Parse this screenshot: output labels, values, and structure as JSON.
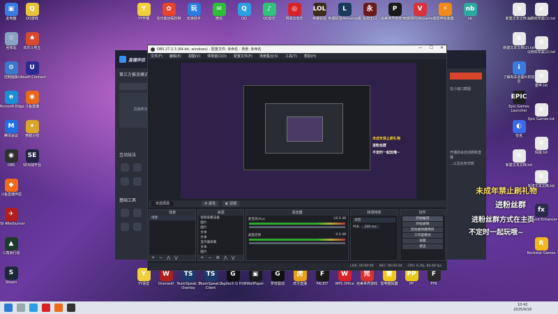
{
  "desktop_icons_left": [
    {
      "label": "此电脑",
      "color": "#3b7be0",
      "glyph": "▣"
    },
    {
      "label": "回收站",
      "color": "#8aa3c2",
      "glyph": "♲"
    },
    {
      "label": "控制面板",
      "color": "#3a78c9",
      "glyph": "⚙"
    },
    {
      "label": "Microsoft Edge",
      "color": "#1a8fd6",
      "glyph": "e"
    },
    {
      "label": "腾讯会议",
      "color": "#1f6fe0",
      "glyph": "M"
    },
    {
      "label": "OBS",
      "color": "#303030",
      "glyph": "◉"
    },
    {
      "label": "斗鱼直播伴侣",
      "color": "#f06a1a",
      "glyph": "◆"
    },
    {
      "label": "MSI Afterburner",
      "color": "#b01e1e",
      "glyph": "✈"
    },
    {
      "label": "三角洲行动",
      "color": "#1f3b2a",
      "glyph": "▲"
    },
    {
      "label": "Steam",
      "color": "#1b2838",
      "glyph": "S"
    }
  ],
  "desktop_icons_left2": [
    {
      "label": "QQ游戏",
      "color": "#e8c23a",
      "glyph": "Q"
    },
    {
      "label": "欢乐斗地主",
      "color": "#d84a2b",
      "glyph": "♠"
    },
    {
      "label": "Ubisoft Connect",
      "color": "#2b2b8f",
      "glyph": "U"
    },
    {
      "label": "斗鱼直播",
      "color": "#e8681a",
      "glyph": "◉"
    },
    {
      "label": "穿越火线",
      "color": "#d8a62b",
      "glyph": "✦"
    },
    {
      "label": "SE对战平台",
      "color": "#222244",
      "glyph": "SE"
    }
  ],
  "desktop_icons_top": [
    {
      "label": "YY开播",
      "color": "#f2d03b",
      "glyph": "Y"
    },
    {
      "label": "向日葵远程控制",
      "color": "#e8442b",
      "glyph": "✿"
    },
    {
      "label": "玩家助手",
      "color": "#2d7be0",
      "glyph": "玩"
    },
    {
      "label": "微信",
      "color": "#2dbe3a",
      "glyph": "✉"
    },
    {
      "label": "QQ",
      "color": "#2d9fe0",
      "glyph": "Q"
    },
    {
      "label": "QQ音乐",
      "color": "#31c27c",
      "glyph": "♪"
    },
    {
      "label": "网易云音乐",
      "color": "#d8222a",
      "glyph": "◎"
    },
    {
      "label": "英雄联盟",
      "color": "#3a2a1a",
      "glyph": "LOL"
    },
    {
      "label": "英雄联盟WeGame版",
      "color": "#1a3a5a",
      "glyph": "L"
    },
    {
      "label": "永劫无间",
      "color": "#6a1a1a",
      "glyph": "永"
    },
    {
      "label": "完美世界竞技平台",
      "color": "#1a1a1a",
      "glyph": "P"
    },
    {
      "label": "无畏契约WeGame版",
      "color": "#d8323a",
      "glyph": "V"
    },
    {
      "label": "雷神加速器",
      "color": "#f08a1a",
      "glyph": "⚡"
    },
    {
      "label": "nb",
      "color": "#2daaa0",
      "glyph": "nb"
    }
  ],
  "desktop_icons_right": [
    {
      "label": "新建文本文档.txt",
      "color": "#e8e8e8",
      "glyph": "≡"
    },
    {
      "label": "新建文本文档(2).txt",
      "color": "#e8e8e8",
      "glyph": "≡"
    },
    {
      "label": "了解有关此图片的信息",
      "color": "#3a7be0",
      "glyph": "i"
    },
    {
      "label": "Epic Games Launcher",
      "color": "#202020",
      "glyph": "EPIC"
    },
    {
      "label": "夸克",
      "color": "#3a6ae8",
      "glyph": "◐"
    },
    {
      "label": "新建文本文档.txt",
      "color": "#e8e8e8",
      "glyph": "≡"
    }
  ],
  "desktop_icons_right2": [
    {
      "label": "马杨欢草案(1).txt",
      "color": "#e8e8e8",
      "glyph": "≡"
    },
    {
      "label": "马杨欢草案(2).txt",
      "color": "#e8e8e8",
      "glyph": "≡"
    },
    {
      "label": "重申.txt",
      "color": "#e8e8e8",
      "glyph": "≡"
    },
    {
      "label": "Epic Games.txt",
      "color": "#e8e8e8",
      "glyph": "≡"
    },
    {
      "label": "情报.txt",
      "color": "#e8e8e8",
      "glyph": "≡"
    },
    {
      "label": "新建文本文档.txt",
      "color": "#e8e8e8",
      "glyph": "≡"
    },
    {
      "label": "fxSound Enhancer",
      "color": "#2a2a4a",
      "glyph": "fx"
    },
    {
      "label": "Rockstar Games",
      "color": "#f0b81a",
      "glyph": "R"
    }
  ],
  "desktop_icons_bottom": [
    {
      "label": "YY语音",
      "color": "#f2d03b",
      "glyph": "Y"
    },
    {
      "label": "Overwolf",
      "color": "#b01e1e",
      "glyph": "W"
    },
    {
      "label": "TeamSpeak 3 Overlay",
      "color": "#1a3a6a",
      "glyph": "TS"
    },
    {
      "label": "TeamSpeak 3 Client",
      "color": "#1a3a6a",
      "glyph": "TS"
    },
    {
      "label": "Logitech G HUB",
      "color": "#111",
      "glyph": "G"
    },
    {
      "label": "WallPaper",
      "color": "#1a1a1a",
      "glyph": "▣"
    },
    {
      "label": "罗技驱动",
      "color": "#111",
      "glyph": "G"
    },
    {
      "label": "虎牙直播",
      "color": "#e8a21a",
      "glyph": "虎"
    },
    {
      "label": "FACEIT",
      "color": "#1a1a1a",
      "glyph": "F"
    },
    {
      "label": "WPS Office",
      "color": "#d8222a",
      "glyph": "W"
    },
    {
      "label": "完美世界游戏",
      "color": "#d8322a",
      "glyph": "完"
    },
    {
      "label": "雷电模拟器",
      "color": "#f0c81a",
      "glyph": "雷"
    },
    {
      "label": "PP",
      "color": "#e8c81a",
      "glyph": "PP"
    },
    {
      "label": "FFR",
      "color": "#2a2a2a",
      "glyph": "F"
    }
  ],
  "bg_app": {
    "title": "直播伴侣",
    "section1": "第三方推流模式",
    "placeholder": "直播推流",
    "section2": "互动玩法",
    "section3": "基础工具",
    "right_texts": [
      "在小窗口截图",
      "开播前会自动刷新直播",
      "...以及任务详情"
    ]
  },
  "obs": {
    "title": "OBS 27.2.3 (64-bit, windows) - 配置文件: 未命名 - 场景: 未命名",
    "menu": [
      "文件(F)",
      "编辑(E)",
      "视图(V)",
      "停靠窗口(D)",
      "配置文件(P)",
      "场景集合(S)",
      "工具(T)",
      "帮助(H)"
    ],
    "source_label": "未选择源",
    "props_btn": "属性",
    "filters_btn": "滤镜",
    "docks": {
      "scenes": {
        "title": "场景",
        "items": [
          "场景"
        ]
      },
      "sources": {
        "title": "来源",
        "items": [
          "视频采集设备",
          "图片",
          "图片",
          "文本",
          "文本",
          "显示器采集",
          "文本",
          "图片"
        ]
      },
      "mixer": {
        "title": "混音器",
        "channels": [
          {
            "name": "麦克风/Aux",
            "db": "-16.0 dB"
          },
          {
            "name": "桌面音频",
            "db": "0.0 dB"
          }
        ]
      },
      "transitions": {
        "title": "转场特效",
        "type": "淡出",
        "duration_label": "时长",
        "duration": "300 ms"
      },
      "controls": {
        "title": "控件",
        "buttons": [
          "开始推流",
          "开始录制",
          "启动虚拟摄像机",
          "工作室模式",
          "设置",
          "退出"
        ]
      }
    },
    "status": [
      "LIVE: 00:00:00",
      "REC: 00:00:00",
      "CPU: 0.3%, 60.00 fps"
    ]
  },
  "overlay": {
    "line1": "未成年禁止刷礼物",
    "line2": "进粉丝群",
    "line3": "进粉丝群方式在主页",
    "line4": "不定时一起玩哦~"
  },
  "taskbar": {
    "time": "10:42",
    "date": "2025/9/18"
  }
}
